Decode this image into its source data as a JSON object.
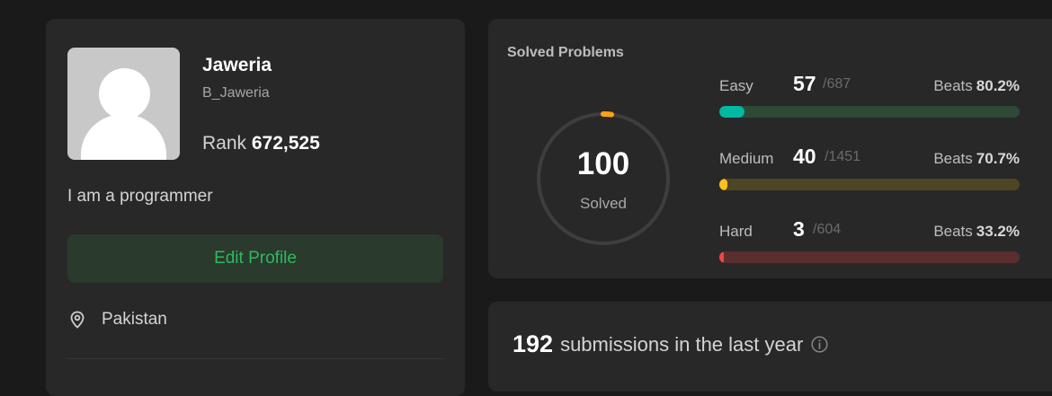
{
  "profile": {
    "name": "Jaweria",
    "username": "B_Jaweria",
    "rank_label": "Rank",
    "rank_value": "672,525",
    "about": "I am a programmer",
    "edit_label": "Edit Profile",
    "location": "Pakistan",
    "location_icon": "location-pin-icon",
    "avatar_icon": "default-avatar-icon"
  },
  "solved": {
    "title": "Solved Problems",
    "total": "100",
    "total_label": "Solved",
    "ring_progress": 0.04,
    "colors": {
      "easy": "#00b8a3",
      "medium": "#ffc01e",
      "hard": "#ef4743",
      "ring_arc": "#ffa116"
    },
    "difficulties": [
      {
        "label": "Easy",
        "solved": "57",
        "total": "/687",
        "beats_label": "Beats",
        "beats": "80.2%",
        "fraction": 0.083,
        "track": "#2c4a36",
        "fill": "#00b8a3"
      },
      {
        "label": "Medium",
        "solved": "40",
        "total": "/1451",
        "beats_label": "Beats",
        "beats": "70.7%",
        "fraction": 0.028,
        "track": "#4e4525",
        "fill": "#ffc01e"
      },
      {
        "label": "Hard",
        "solved": "3",
        "total": "/604",
        "beats_label": "Beats",
        "beats": "33.2%",
        "fraction": 0.005,
        "track": "#5a2e2d",
        "fill": "#ef4743"
      }
    ]
  },
  "submissions": {
    "count": "192",
    "text": "submissions in the last year",
    "info_icon": "info-icon"
  }
}
